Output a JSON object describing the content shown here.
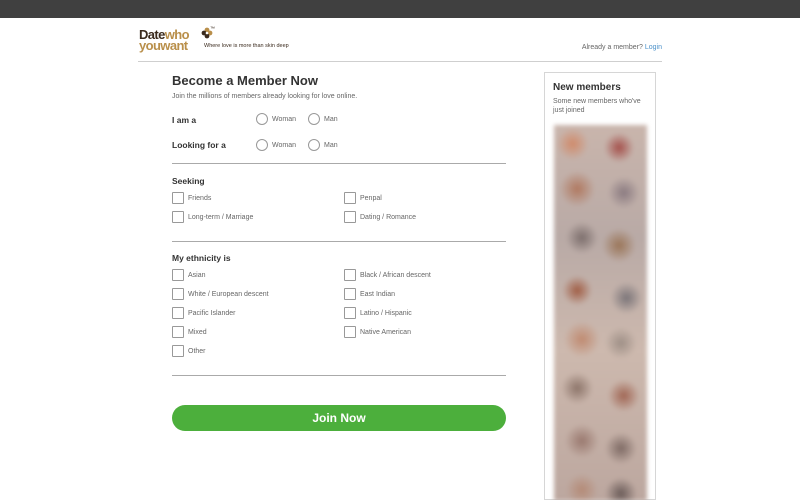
{
  "header": {
    "logo_line1_dark": "Date",
    "logo_line1_gold": "who",
    "logo_line2": "youwant",
    "logo_tm": "™",
    "tagline": "Where love is more than skin deep",
    "already_member": "Already a member?",
    "login_link": "Login"
  },
  "form": {
    "title": "Become a Member Now",
    "subtitle": "Join the millions of members already looking for love online.",
    "i_am_label": "I am a",
    "i_am_options": [
      "Woman",
      "Man"
    ],
    "looking_for_label": "Looking for a",
    "looking_for_options": [
      "Woman",
      "Man"
    ],
    "seeking_title": "Seeking",
    "seeking_options": [
      "Friends",
      "Penpal",
      "Long-term / Marriage",
      "Dating / Romance"
    ],
    "ethnicity_title": "My ethnicity is",
    "ethnicity_options": [
      "Asian",
      "Black / African descent",
      "White / European descent",
      "East Indian",
      "Pacific Islander",
      "Latino / Hispanic",
      "Mixed",
      "Native American",
      "Other"
    ],
    "join_button": "Join Now"
  },
  "sidebar": {
    "title": "New members",
    "subtitle": "Some new members who've just joined"
  },
  "colors": {
    "accent_green": "#4caf3c",
    "link_blue": "#4a90c9",
    "logo_dark": "#3a2a1d",
    "logo_gold": "#b98f4a",
    "top_bar": "#404040"
  }
}
